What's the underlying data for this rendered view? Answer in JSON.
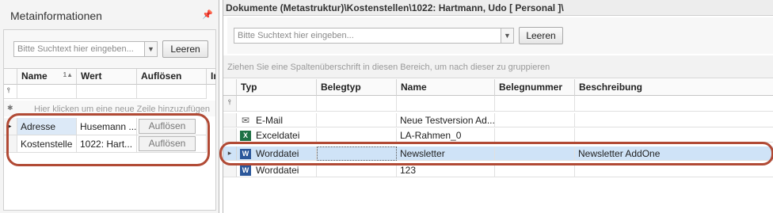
{
  "left_panel": {
    "title": "Metainformationen",
    "pin_glyph": "📌",
    "search": {
      "placeholder": "Bitte Suchtext hier eingeben...",
      "clear_label": "Leeren"
    },
    "columns": [
      "Name",
      "Wert",
      "Auflösen",
      "In"
    ],
    "sort_glyph": "1▲",
    "filter_glyph": "⫯",
    "new_row_glyph": "✱",
    "new_row_hint": "Hier klicken um eine neue Zeile hinzuzufügen",
    "current_row_glyph": "▸",
    "rows": [
      {
        "name": "Adresse",
        "value": "Husemann ...",
        "action": "Auflösen"
      },
      {
        "name": "Kostenstelle",
        "value": "1022: Hart...",
        "action": "Auflösen"
      }
    ]
  },
  "right_panel": {
    "title": "Dokumente (Metastruktur)\\Kostenstellen\\1022: Hartmann, Udo [ Personal ]\\",
    "search": {
      "placeholder": "Bitte Suchtext hier eingeben...",
      "clear_label": "Leeren"
    },
    "group_hint": "Ziehen Sie eine Spaltenüberschrift in diesen Bereich, um nach dieser zu gruppieren",
    "columns": [
      "Typ",
      "Belegtyp",
      "Name",
      "Belegnummer",
      "Beschreibung"
    ],
    "filter_glyph": "⫯",
    "current_row_glyph": "▸",
    "rows": [
      {
        "icon": "mail-icon",
        "type": "E-Mail",
        "belegtyp": "",
        "name": "Neue Testversion Ad...",
        "belegnummer": "",
        "beschreibung": ""
      },
      {
        "icon": "excel-icon",
        "type": "Exceldatei",
        "belegtyp": "",
        "name": "LA-Rahmen_0",
        "belegnummer": "",
        "beschreibung": ""
      },
      {
        "icon": "word-icon",
        "type": "Worddatei",
        "belegtyp": "",
        "name": "Newsletter",
        "belegnummer": "",
        "beschreibung": "Newsletter AddOne"
      },
      {
        "icon": "word-icon",
        "type": "Worddatei",
        "belegtyp": "",
        "name": "123",
        "belegnummer": "",
        "beschreibung": ""
      }
    ]
  },
  "colors": {
    "selection": "#cfe3f7",
    "annotation": "#b14a35",
    "excel": "#1e7145",
    "word": "#2b579a"
  }
}
